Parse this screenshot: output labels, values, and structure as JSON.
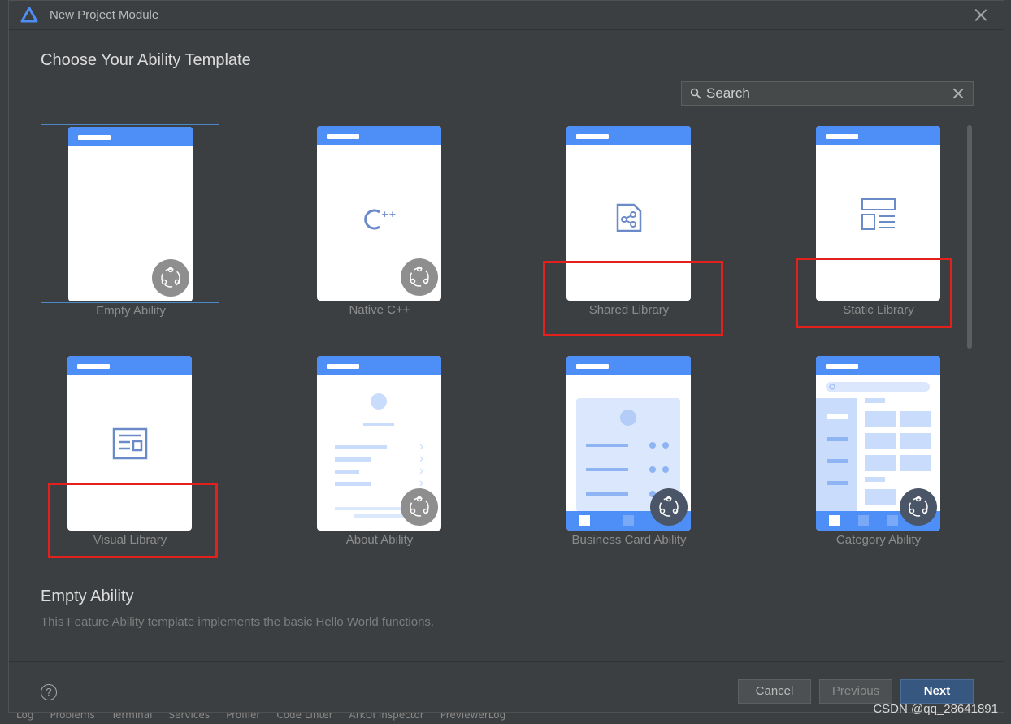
{
  "window": {
    "title": "New Project Module"
  },
  "heading": "Choose Your Ability Template",
  "search": {
    "placeholder": "Search"
  },
  "templates": [
    {
      "label": "Empty Ability",
      "selected": true
    },
    {
      "label": "Native C++"
    },
    {
      "label": "Shared Library"
    },
    {
      "label": "Static Library"
    },
    {
      "label": "Visual Library"
    },
    {
      "label": "About Ability"
    },
    {
      "label": "Business Card Ability"
    },
    {
      "label": "Category Ability"
    }
  ],
  "description": {
    "title": "Empty Ability",
    "text": "This Feature Ability template implements the basic Hello World functions."
  },
  "footer": {
    "help": "?",
    "cancel": "Cancel",
    "previous": "Previous",
    "next": "Next"
  },
  "watermark": "CSDN @qq_28641891",
  "ide_tabs": [
    "Log",
    "Problems",
    "Terminal",
    "Services",
    "Profiler",
    "Code Linter",
    "ArkUI Inspector",
    "PreviewerLog"
  ],
  "colors": {
    "accent": "#4d8ef7",
    "highlight": "#e3201b",
    "primary_button": "#365880"
  }
}
